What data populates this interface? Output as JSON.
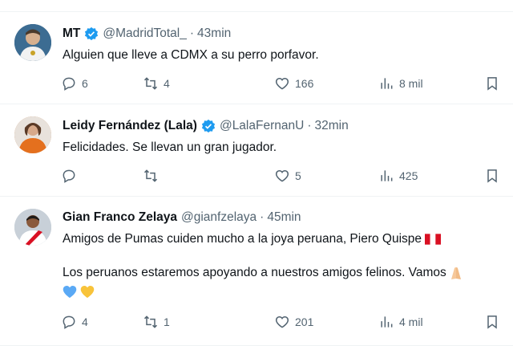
{
  "posts": [
    {
      "name": "MT",
      "handle": "@MadridTotal_",
      "time": "43min",
      "text": [
        "Alguien que lleve a CDMX a su perro porfavor."
      ],
      "replies": "6",
      "reposts": "4",
      "likes": "166",
      "views": "8 mil"
    },
    {
      "name": "Leidy Fernández (Lala)",
      "handle": "@LalaFernanU",
      "time": "32min",
      "text": [
        "Felicidades. Se llevan un gran jugador."
      ],
      "replies": "",
      "reposts": "",
      "likes": "5",
      "views": "425"
    },
    {
      "name": "Gian Franco Zelaya",
      "handle": "@gianfzelaya",
      "time": "45min",
      "text": [
        "Amigos de Pumas cuiden mucho a la joya peruana, Piero Quispe",
        "Los peruanos estaremos apoyando a nuestros amigos felinos. Vamos"
      ],
      "replies": "4",
      "reposts": "1",
      "likes": "201",
      "views": "4 mil"
    }
  ],
  "icons": {
    "verified": "verified-badge-icon",
    "reply": "reply-icon",
    "repost": "repost-icon",
    "like": "like-icon",
    "views": "views-icon",
    "bookmark": "bookmark-icon"
  },
  "colors": {
    "verified": "#1d9bf0",
    "secondary_text": "#536471",
    "divider": "#eff3f4"
  }
}
